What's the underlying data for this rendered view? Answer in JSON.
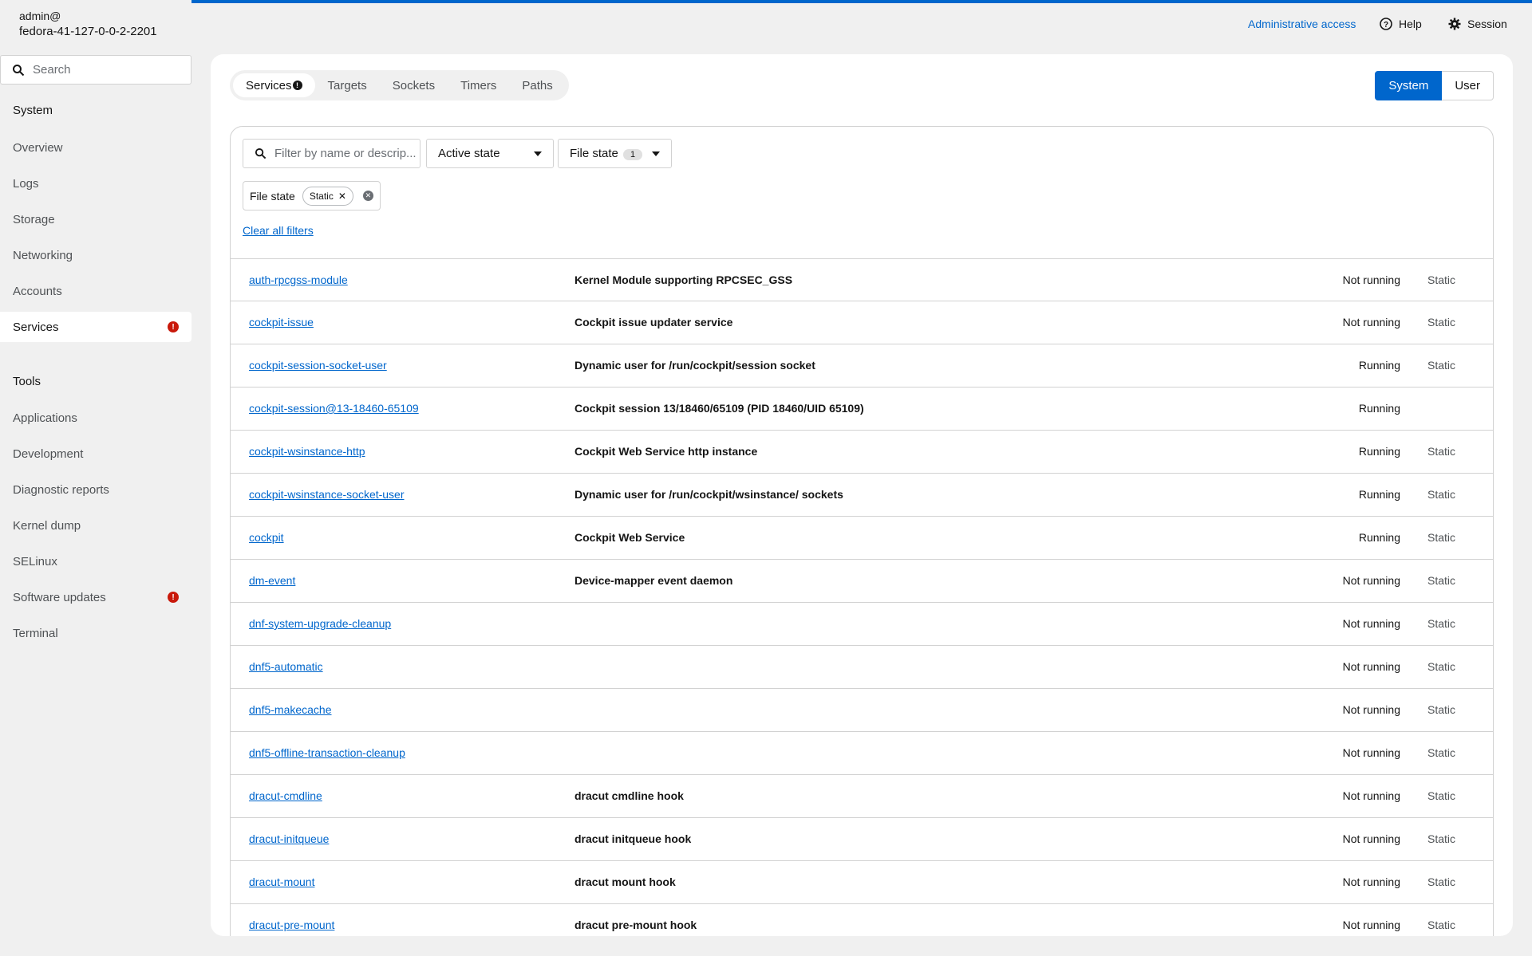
{
  "host": {
    "user": "admin@",
    "name": "fedora-41-127-0-0-2-2201"
  },
  "sidebar": {
    "search_placeholder": "Search",
    "system_label": "System",
    "system_items": [
      {
        "label": "Overview"
      },
      {
        "label": "Logs"
      },
      {
        "label": "Storage"
      },
      {
        "label": "Networking"
      },
      {
        "label": "Accounts"
      },
      {
        "label": "Services",
        "badge": "!"
      }
    ],
    "tools_label": "Tools",
    "tools_items": [
      {
        "label": "Applications"
      },
      {
        "label": "Development"
      },
      {
        "label": "Diagnostic reports"
      },
      {
        "label": "Kernel dump"
      },
      {
        "label": "SELinux"
      },
      {
        "label": "Software updates",
        "badge": "!"
      },
      {
        "label": "Terminal"
      }
    ]
  },
  "header": {
    "admin": "Administrative access",
    "help": "Help",
    "session": "Session"
  },
  "tabs": [
    {
      "label": "Services",
      "badge": "!"
    },
    {
      "label": "Targets"
    },
    {
      "label": "Sockets"
    },
    {
      "label": "Timers"
    },
    {
      "label": "Paths"
    }
  ],
  "toggle": {
    "system": "System",
    "user": "User"
  },
  "filters": {
    "search_placeholder": "Filter by name or descrip...",
    "active_state": "Active state",
    "file_state": "File state",
    "file_state_count": "1",
    "chip_group_label": "File state",
    "chip": "Static",
    "clear_all": "Clear all filters"
  },
  "services": [
    {
      "name": "auth-rpcgss-module",
      "desc": "Kernel Module supporting RPCSEC_GSS",
      "state": "Not running",
      "file": "Static"
    },
    {
      "name": "cockpit-issue",
      "desc": "Cockpit issue updater service",
      "state": "Not running",
      "file": "Static"
    },
    {
      "name": "cockpit-session-socket-user",
      "desc": "Dynamic user for /run/cockpit/session socket",
      "state": "Running",
      "file": "Static"
    },
    {
      "name": "cockpit-session@13-18460-65109",
      "desc": "Cockpit session 13/18460/65109 (PID 18460/UID 65109)",
      "state": "Running",
      "file": ""
    },
    {
      "name": "cockpit-wsinstance-http",
      "desc": "Cockpit Web Service http instance",
      "state": "Running",
      "file": "Static"
    },
    {
      "name": "cockpit-wsinstance-socket-user",
      "desc": "Dynamic user for /run/cockpit/wsinstance/ sockets",
      "state": "Running",
      "file": "Static"
    },
    {
      "name": "cockpit",
      "desc": "Cockpit Web Service",
      "state": "Running",
      "file": "Static"
    },
    {
      "name": "dm-event",
      "desc": "Device-mapper event daemon",
      "state": "Not running",
      "file": "Static"
    },
    {
      "name": "dnf-system-upgrade-cleanup",
      "desc": "",
      "state": "Not running",
      "file": "Static"
    },
    {
      "name": "dnf5-automatic",
      "desc": "",
      "state": "Not running",
      "file": "Static"
    },
    {
      "name": "dnf5-makecache",
      "desc": "",
      "state": "Not running",
      "file": "Static"
    },
    {
      "name": "dnf5-offline-transaction-cleanup",
      "desc": "",
      "state": "Not running",
      "file": "Static"
    },
    {
      "name": "dracut-cmdline",
      "desc": "dracut cmdline hook",
      "state": "Not running",
      "file": "Static"
    },
    {
      "name": "dracut-initqueue",
      "desc": "dracut initqueue hook",
      "state": "Not running",
      "file": "Static"
    },
    {
      "name": "dracut-mount",
      "desc": "dracut mount hook",
      "state": "Not running",
      "file": "Static"
    },
    {
      "name": "dracut-pre-mount",
      "desc": "dracut pre-mount hook",
      "state": "Not running",
      "file": "Static"
    }
  ]
}
